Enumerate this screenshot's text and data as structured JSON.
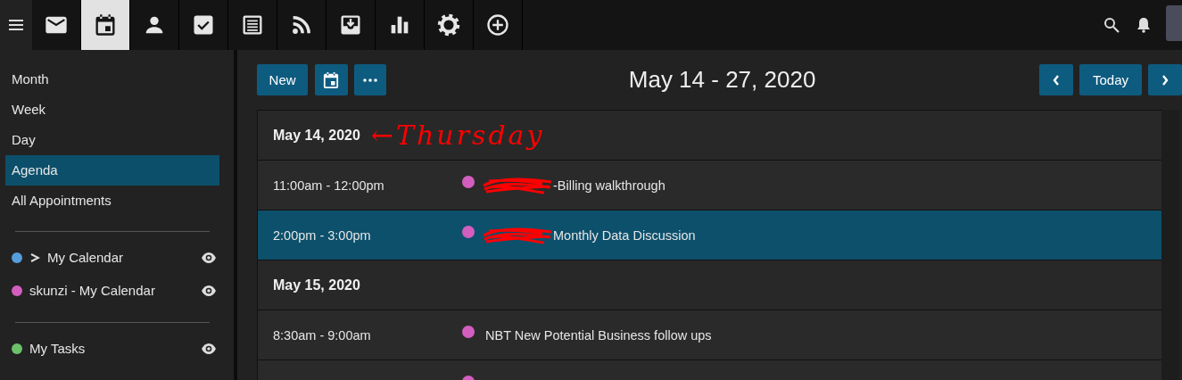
{
  "top_nav": {
    "items": [
      {
        "kind": "mail",
        "selected": false
      },
      {
        "kind": "calendar",
        "selected": true
      },
      {
        "kind": "person",
        "selected": false
      },
      {
        "kind": "tasks",
        "selected": false
      },
      {
        "kind": "notes",
        "selected": false
      },
      {
        "kind": "feed",
        "selected": false
      },
      {
        "kind": "inbox",
        "selected": false
      },
      {
        "kind": "chart",
        "selected": false
      },
      {
        "kind": "settings",
        "selected": false
      },
      {
        "kind": "add",
        "selected": false
      }
    ]
  },
  "sidebar": {
    "views": [
      {
        "label": "Month",
        "selected": false
      },
      {
        "label": "Week",
        "selected": false
      },
      {
        "label": "Day",
        "selected": false
      },
      {
        "label": "Agenda",
        "selected": true
      },
      {
        "label": "All Appointments",
        "selected": false
      }
    ],
    "calendar_groups": [
      {
        "calendars": [
          {
            "name": "My Calendar",
            "color": "#569ddb",
            "shared": true
          },
          {
            "name": "skunzi - My Calendar",
            "color": "#d35ec0",
            "shared": false
          }
        ]
      },
      {
        "calendars": [
          {
            "name": "My Tasks",
            "color": "#6cc06a",
            "shared": false
          }
        ]
      }
    ]
  },
  "toolbar": {
    "new_label": "New",
    "title": "May 14 - 27, 2020",
    "today_label": "Today"
  },
  "agenda": {
    "days": [
      {
        "date": "May 14, 2020",
        "annotation": "←Thursday",
        "events": [
          {
            "time": "11:00am - 12:00pm",
            "title": "-Billing walkthrough",
            "color": "#d35ec0",
            "selected": false,
            "redacted": true
          },
          {
            "time": "2:00pm - 3:00pm",
            "title": "Monthly Data Discussion",
            "color": "#d35ec0",
            "selected": true,
            "redacted": true
          }
        ]
      },
      {
        "date": "May 15, 2020",
        "events": [
          {
            "time": "8:30am - 9:00am",
            "title": "NBT New Potential Business follow ups",
            "color": "#d35ec0",
            "selected": false,
            "redacted": false
          },
          {
            "color": "#d35ec0",
            "selected": false,
            "redacted": false
          }
        ]
      }
    ]
  }
}
